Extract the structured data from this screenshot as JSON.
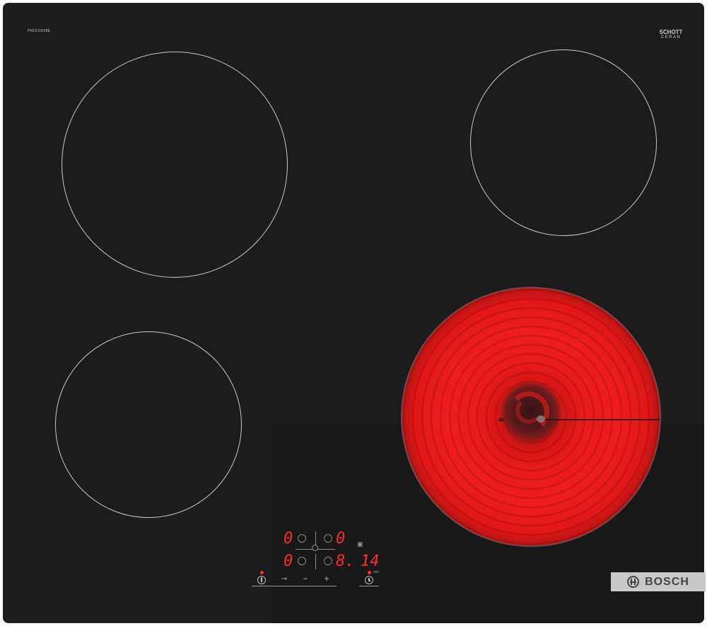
{
  "appliance": {
    "model_label": "PKE611B08E",
    "surface_brand_line1": "SCHOTT",
    "surface_brand_line2": "CERAN",
    "surface_brand_line3": "",
    "brand_name": "BOSCH",
    "brand_logo": "bosch-armature-icon"
  },
  "zones": [
    {
      "name": "front-left",
      "active": false
    },
    {
      "name": "rear-left",
      "active": false
    },
    {
      "name": "rear-right",
      "active": false
    },
    {
      "name": "front-right",
      "active": true,
      "glow_color": "#ee1c1c"
    }
  ],
  "display": {
    "row1_left": "0",
    "row1_right": "0",
    "row2_left": "0",
    "row2_right": "8.",
    "timer_value": "14",
    "timer_unit": "min"
  },
  "controls": {
    "power_icon": "power-icon",
    "lock_icon": "key-lock-icon",
    "minus_label": "−",
    "plus_label": "+",
    "timer_icon": "timer-icon"
  },
  "colors": {
    "surface": "#1c1c1c",
    "display_red": "#ff2a2a",
    "zone_outline": "#c9c9c9",
    "brand_plate": "#c8c8c8"
  }
}
